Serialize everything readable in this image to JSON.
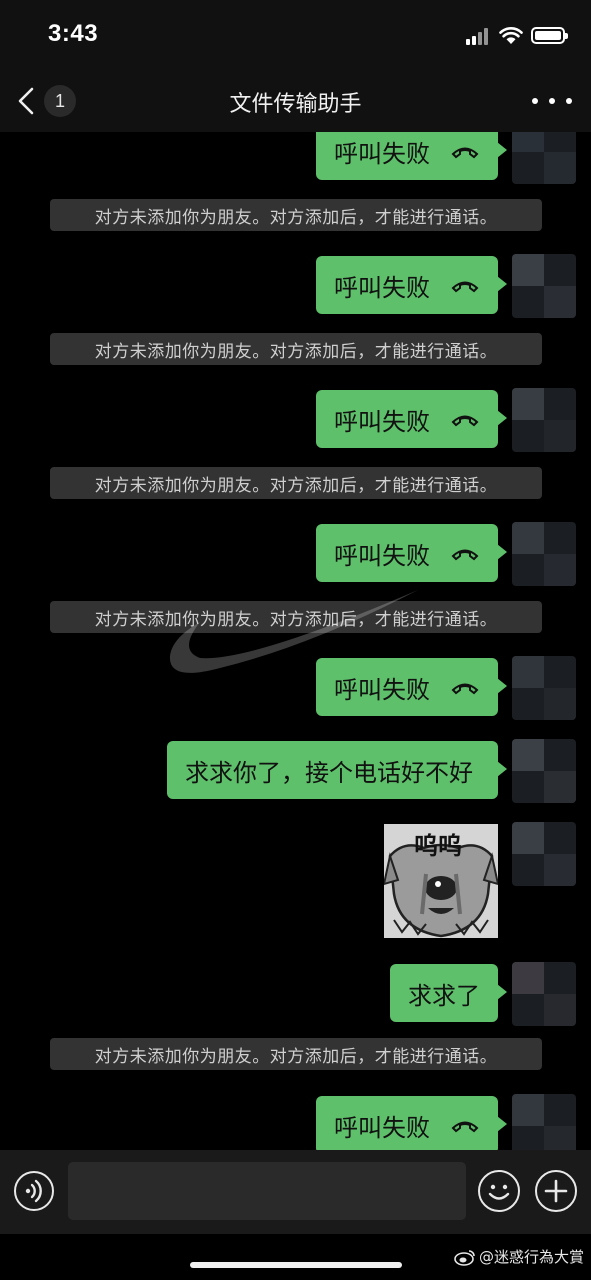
{
  "status_bar": {
    "time": "3:43",
    "icons": [
      "signal-icon",
      "wifi-icon",
      "battery-icon"
    ]
  },
  "header": {
    "back_icon": "chevron-left-icon",
    "unread_count": "1",
    "title": "文件传输助手",
    "more_icon": "more-dots-icon"
  },
  "messages": [
    {
      "type": "call",
      "text": "呼叫失败",
      "icon": "hangup-icon"
    },
    {
      "type": "system",
      "text": "对方未添加你为朋友。对方添加后，才能进行通话。"
    },
    {
      "type": "call",
      "text": "呼叫失败",
      "icon": "hangup-icon"
    },
    {
      "type": "system",
      "text": "对方未添加你为朋友。对方添加后，才能进行通话。"
    },
    {
      "type": "call",
      "text": "呼叫失败",
      "icon": "hangup-icon"
    },
    {
      "type": "system",
      "text": "对方未添加你为朋友。对方添加后，才能进行通话。"
    },
    {
      "type": "call",
      "text": "呼叫失败",
      "icon": "hangup-icon"
    },
    {
      "type": "system",
      "text": "对方未添加你为朋友。对方添加后，才能进行通话。"
    },
    {
      "type": "call",
      "text": "呼叫失败",
      "icon": "hangup-icon"
    },
    {
      "type": "text",
      "text": "求求你了，接个电话好不好"
    },
    {
      "type": "sticker",
      "text": "呜呜"
    },
    {
      "type": "text",
      "text": "求求了"
    },
    {
      "type": "system",
      "text": "对方未添加你为朋友。对方添加后，才能进行通话。"
    },
    {
      "type": "call",
      "text": "呼叫失败",
      "icon": "hangup-icon"
    }
  ],
  "input_bar": {
    "voice_icon": "voice-icon",
    "input_value": "",
    "emoji_icon": "emoji-icon",
    "plus_icon": "plus-icon"
  },
  "watermark": {
    "text": "@迷惑行為大賞",
    "icon": "weibo-logo-icon"
  },
  "colors": {
    "bubble": "#5ec06a",
    "background": "#000000",
    "system_notice_bg": "#333333",
    "bars": "#111111"
  }
}
